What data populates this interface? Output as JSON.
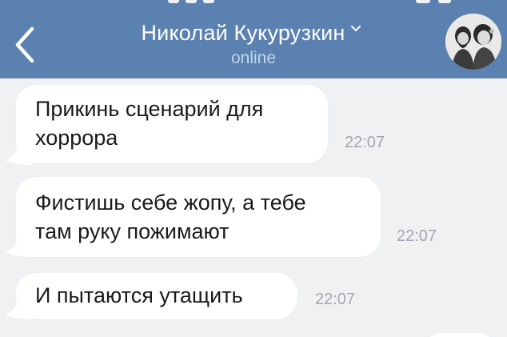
{
  "header": {
    "back_icon": "chevron-left-icon",
    "contact_name": "Николай Кукурузкин",
    "dropdown_icon": "chevron-down-icon",
    "presence": "online",
    "avatar_icon": "avatar-image",
    "background_color": "#5b81b1"
  },
  "messages": [
    {
      "text": "Прикинь сценарий для\nхоррора",
      "time": "22:07"
    },
    {
      "text": "Фистишь себе жопу, а тебе\nтам руку пожимают",
      "time": "22:07"
    },
    {
      "text": "И пытаются утащить",
      "time": "22:07"
    }
  ],
  "colors": {
    "chat_background": "#f0f1f3",
    "bubble": "#ffffff",
    "time": "#a3a7ad"
  }
}
